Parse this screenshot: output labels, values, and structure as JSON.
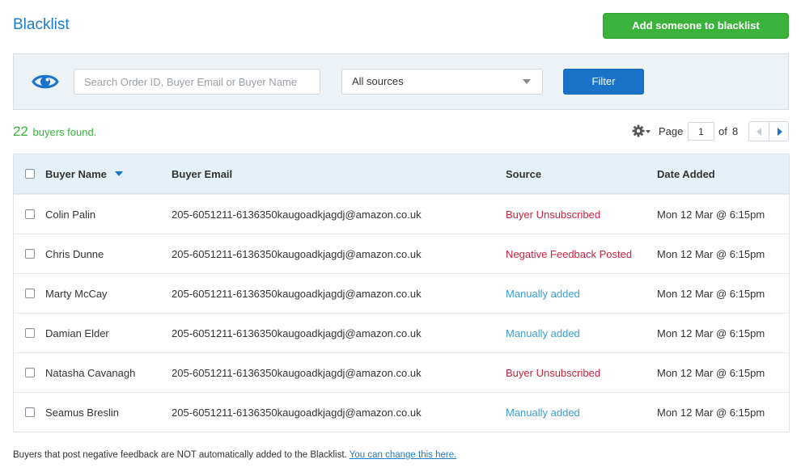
{
  "header": {
    "title": "Blacklist",
    "add_button_label": "Add someone to blacklist"
  },
  "filter": {
    "search_placeholder": "Search Order ID, Buyer Email or Buyer Name",
    "search_value": "",
    "source_selected": "All sources",
    "filter_button_label": "Filter"
  },
  "results": {
    "count": "22",
    "found_text": "buyers found."
  },
  "pagination": {
    "page_label": "Page",
    "current_page": "1",
    "of_label": "of",
    "total_pages": "8"
  },
  "table": {
    "columns": {
      "name": "Buyer Name",
      "email": "Buyer Email",
      "source": "Source",
      "date": "Date Added"
    },
    "rows": [
      {
        "name": "Colin Palin",
        "email": "205-6051211-6136350kaugoadkjagdj@amazon.co.uk",
        "source": "Buyer Unsubscribed",
        "source_type": "red",
        "date": "Mon 12 Mar @ 6:15pm"
      },
      {
        "name": "Chris Dunne",
        "email": "205-6051211-6136350kaugoadkjagdj@amazon.co.uk",
        "source": "Negative Feedback Posted",
        "source_type": "red",
        "date": "Mon 12 Mar @ 6:15pm"
      },
      {
        "name": "Marty McCay",
        "email": "205-6051211-6136350kaugoadkjagdj@amazon.co.uk",
        "source": "Manually added",
        "source_type": "blue",
        "date": "Mon 12 Mar @ 6:15pm"
      },
      {
        "name": "Damian Elder",
        "email": "205-6051211-6136350kaugoadkjagdj@amazon.co.uk",
        "source": "Manually added",
        "source_type": "blue",
        "date": "Mon 12 Mar @ 6:15pm"
      },
      {
        "name": "Natasha Cavanagh",
        "email": "205-6051211-6136350kaugoadkjagdj@amazon.co.uk",
        "source": "Buyer Unsubscribed",
        "source_type": "red",
        "date": "Mon 12 Mar @ 6:15pm"
      },
      {
        "name": "Seamus Breslin",
        "email": "205-6051211-6136350kaugoadkjagdj@amazon.co.uk",
        "source": "Manually added",
        "source_type": "blue",
        "date": "Mon 12 Mar @ 6:15pm"
      }
    ]
  },
  "footer": {
    "note": "Buyers that post negative feedback are NOT automatically added to the Blacklist.",
    "link_label": "You can change this here."
  },
  "colors": {
    "accent_blue": "#1e7bc4",
    "success_green": "#3bb33b",
    "source_red": "#c9233f",
    "source_blue": "#3a9fd1"
  },
  "icons": {
    "view": "eye-icon",
    "settings": "gear-icon",
    "sort": "sort-desc-icon",
    "select_caret": "caret-down-icon",
    "prev": "chevron-left-icon",
    "next": "chevron-right-icon"
  }
}
